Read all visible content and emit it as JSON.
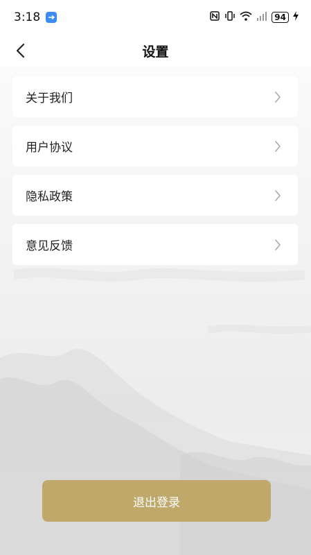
{
  "status_bar": {
    "time": "3:18",
    "battery": "94"
  },
  "nav": {
    "title": "设置"
  },
  "menu": {
    "items": [
      {
        "label": "关于我们"
      },
      {
        "label": "用户协议"
      },
      {
        "label": "隐私政策"
      },
      {
        "label": "意见反馈"
      }
    ]
  },
  "actions": {
    "logout_label": "退出登录"
  },
  "colors": {
    "accent": "#bfa86a",
    "usb_badge": "#3d8bf5"
  }
}
